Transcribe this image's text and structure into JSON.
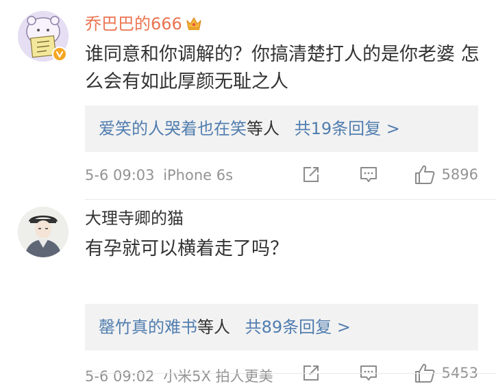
{
  "comments": [
    {
      "username": "乔巴巴的666",
      "crown_icon": "crown-icon",
      "badge_icon": "verified-badge-icon",
      "content": "谁同意和你调解的？你搞清楚打人的是你老婆 怎么会有如此厚颜无耻之人",
      "reply_user": "爱笑的人哭着也在笑",
      "reply_suffix": "等人",
      "reply_count": "共19条回复 >",
      "time": "5-6 09:03",
      "source": "iPhone 6s",
      "like_count": "5896"
    },
    {
      "username": "大理寺卿的猫",
      "content": "有孕就可以横着走了吗？",
      "reply_user": "罄竹真的难书",
      "reply_suffix": "等人",
      "reply_count": "共89条回复 >",
      "time": "5-6 09:02",
      "source": "小米5X 拍人更美",
      "like_count": "5453"
    }
  ],
  "colors": {
    "username_vip": "#eb7350",
    "link": "#507daf",
    "meta": "#939393",
    "reply_bg": "#f2f2f2",
    "badge": "#f5a623"
  },
  "icons": [
    "share-icon",
    "comment-icon",
    "like-icon"
  ]
}
